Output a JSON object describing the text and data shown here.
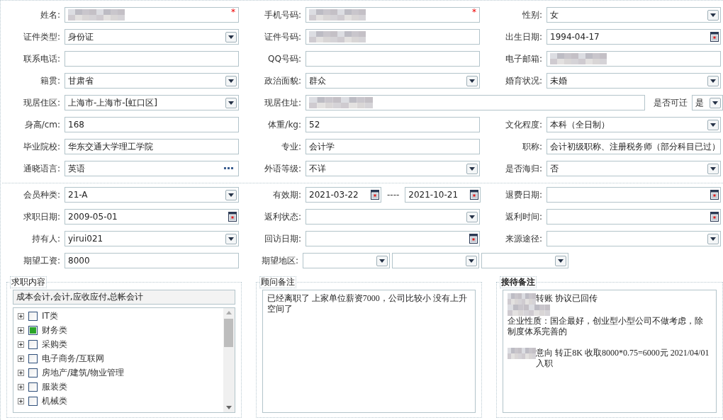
{
  "personal_rows": [
    {
      "cells": [
        {
          "label": "姓名:",
          "kind": "text",
          "redacted": true,
          "required_mark": "*"
        },
        {
          "label": "手机号码:",
          "kind": "text",
          "redacted": true,
          "required_mark": "*"
        },
        {
          "label": "性别:",
          "kind": "select",
          "value": "女"
        }
      ]
    },
    {
      "cells": [
        {
          "label": "证件类型:",
          "kind": "select",
          "value": "身份证"
        },
        {
          "label": "证件号码:",
          "kind": "text",
          "redacted": true
        },
        {
          "label": "出生日期:",
          "kind": "date",
          "value": "1994-04-17"
        }
      ]
    },
    {
      "cells": [
        {
          "label": "联系电话:",
          "kind": "text"
        },
        {
          "label": "QQ号码:",
          "kind": "text"
        },
        {
          "label": "电子邮箱:",
          "kind": "text",
          "redacted": true
        }
      ]
    },
    {
      "cells": [
        {
          "label": "籍贯:",
          "kind": "select",
          "value": "甘肃省"
        },
        {
          "label": "政治面貌:",
          "kind": "select",
          "value": "群众"
        },
        {
          "label": "婚育状况:",
          "kind": "select",
          "value": "未婚"
        }
      ]
    },
    {
      "cells": [
        {
          "label": "现居住区:",
          "kind": "select",
          "value": " 上海市-上海市-[虹口区]"
        },
        {
          "label": "现居住址:",
          "kind": "text",
          "redacted": true
        },
        {
          "label": "是否可迁",
          "kind": "compact-select",
          "value": "是"
        }
      ]
    },
    {
      "cells": [
        {
          "label": "身高/cm:",
          "kind": "text",
          "value": "168"
        },
        {
          "label": "体重/kg:",
          "kind": "text",
          "value": "52"
        },
        {
          "label": "文化程度:",
          "kind": "select",
          "value": "本科（全日制）"
        }
      ]
    },
    {
      "cells": [
        {
          "label": "毕业院校:",
          "kind": "text",
          "value": "华东交通大学理工学院"
        },
        {
          "label": "专业:",
          "kind": "text",
          "value": "会计学"
        },
        {
          "label": "职称:",
          "kind": "text",
          "value": "会计初级职称、注册税务师（部分科目已过）"
        }
      ]
    },
    {
      "cells": [
        {
          "label": "通晓语言:",
          "kind": "more",
          "value": "英语"
        },
        {
          "label": "外语等级:",
          "kind": "select",
          "value": "不详"
        },
        {
          "label": "是否海归:",
          "kind": "select",
          "value": "否"
        }
      ]
    }
  ],
  "membership_rows": [
    {
      "cells": [
        {
          "label": "会员种类:",
          "kind": "select",
          "value": " 21-A"
        },
        {
          "label": "有效期:",
          "kind": "date-range",
          "value": "2021-03-22",
          "separator": "----",
          "value_end": "2021-10-21"
        },
        {
          "label": "退费日期:",
          "kind": "date"
        }
      ]
    },
    {
      "cells": [
        {
          "label": "求职日期:",
          "kind": "date",
          "value": "2009-05-01"
        },
        {
          "label": "返利状态:",
          "kind": "select"
        },
        {
          "label": "返利时间:",
          "kind": "date"
        }
      ]
    },
    {
      "cells": [
        {
          "label": "持有人:",
          "kind": "select",
          "value": "yirui021"
        },
        {
          "label": "回访日期:",
          "kind": "date"
        },
        {
          "label": "来源途径:",
          "kind": "select"
        }
      ]
    },
    {
      "cells": [
        {
          "label": "期望工资:",
          "kind": "text",
          "value": "8000"
        },
        {
          "label": "期望地区:",
          "kind": "region-select"
        }
      ]
    }
  ],
  "job_content": {
    "title": "求职内容",
    "summary": "成本会计,会计,应收应付,总帐会计",
    "items": [
      {
        "label": "IT类",
        "checked": false,
        "expanded": false
      },
      {
        "label": "财务类",
        "checked": true,
        "expanded": false
      },
      {
        "label": "采购类",
        "checked": false,
        "expanded": false
      },
      {
        "label": "电子商务/互联网",
        "checked": false,
        "expanded": false
      },
      {
        "label": "房地产/建筑/物业管理",
        "checked": false,
        "expanded": false
      },
      {
        "label": "服装类",
        "checked": false,
        "expanded": false
      },
      {
        "label": "机械类",
        "checked": false,
        "expanded": false
      }
    ]
  },
  "advisor_notes": {
    "title": "顾问备注",
    "lines": [
      {
        "text": "已经离职了  上家单位薪资7000，公司比较小 没有上升空间了"
      }
    ]
  },
  "reception_notes": {
    "title": "接待备注",
    "lines": [
      {
        "redacted": true,
        "text": " 转账 协议已回传"
      },
      {
        "redacted": true
      },
      {
        "text": "企业性质：国企最好，创业型小型公司不做考虑，除制度体系完善的"
      },
      {
        "redacted": true,
        "gap_before": true,
        "text": "意向 转正8K  收取8000*0.75=6000元 2021/04/01 入职"
      }
    ]
  }
}
